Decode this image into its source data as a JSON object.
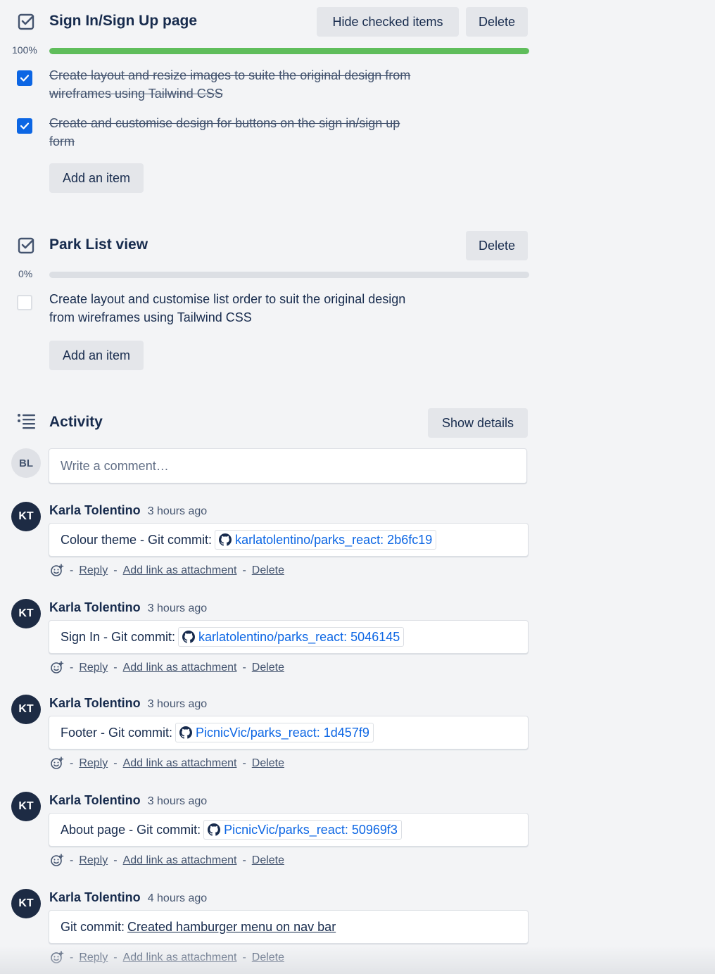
{
  "checklists": [
    {
      "title": "Sign In/Sign Up page",
      "percent_label": "100%",
      "progress": 1.0,
      "hide_checked_label": "Hide checked items",
      "delete_label": "Delete",
      "items": [
        {
          "checked": true,
          "line1": "Create layout and resize images to suite the original design from",
          "line2": "wireframes using Tailwind CSS"
        },
        {
          "checked": true,
          "line1": "Create and customise design for buttons on the sign in/sign up",
          "line2": "form"
        }
      ],
      "add_item_label": "Add an item"
    },
    {
      "title": "Park List view",
      "percent_label": "0%",
      "progress": 0.0,
      "delete_label": "Delete",
      "items": [
        {
          "checked": false,
          "line1": "Create layout and customise list order to suit the original design",
          "line2": "from wireframes using Tailwind CSS"
        }
      ],
      "add_item_label": "Add an item"
    }
  ],
  "activity": {
    "title": "Activity",
    "show_details_label": "Show details",
    "current_user_initials": "BL",
    "comment_placeholder": "Write a comment…",
    "comments": [
      {
        "initials": "KT",
        "author": "Karla Tolentino",
        "time": "3 hours ago",
        "prefix": "Colour theme - Git commit:",
        "link": "karlatolentino/parks_react: 2b6fc19",
        "link_type": "chip"
      },
      {
        "initials": "KT",
        "author": "Karla Tolentino",
        "time": "3 hours ago",
        "prefix": "Sign In - Git commit:",
        "link": "karlatolentino/parks_react: 5046145",
        "link_type": "chip"
      },
      {
        "initials": "KT",
        "author": "Karla Tolentino",
        "time": "3 hours ago",
        "prefix": "Footer - Git commit:",
        "link": "PicnicVic/parks_react: 1d457f9",
        "link_type": "chip"
      },
      {
        "initials": "KT",
        "author": "Karla Tolentino",
        "time": "3 hours ago",
        "prefix": "About page - Git commit:",
        "link": "PicnicVic/parks_react: 50969f3",
        "link_type": "chip"
      },
      {
        "initials": "KT",
        "author": "Karla Tolentino",
        "time": "4 hours ago",
        "prefix": "Git commit:",
        "link": "Created hamburger menu on nav bar",
        "link_type": "underline"
      }
    ],
    "actions": {
      "sep": "-",
      "reply": "Reply",
      "add_link": "Add link as attachment",
      "delete": "Delete"
    }
  },
  "icons": {
    "checklist": "checklist-icon",
    "activity": "activity-list-icon",
    "reaction": "add-reaction-icon",
    "github": "github-icon",
    "checkmark": "checkmark-icon"
  },
  "colors": {
    "progress_complete": "#5fbd5b",
    "checkbox_checked": "#0c66e4",
    "link": "#0c66e4",
    "avatar": "#1d2b44"
  }
}
